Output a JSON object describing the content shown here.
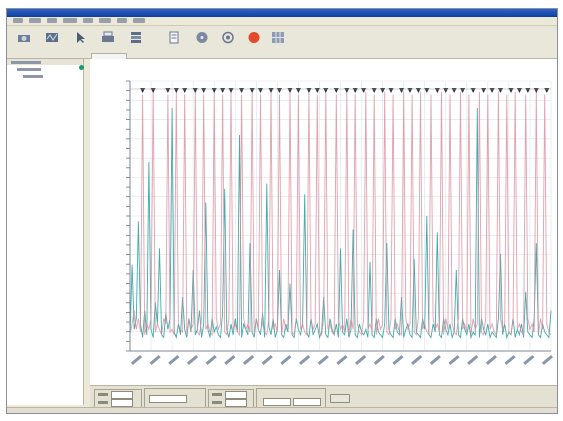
{
  "window": {
    "title": ""
  },
  "menu": {
    "items": [
      "",
      "",
      "",
      "",
      "",
      "",
      "",
      ""
    ]
  },
  "toolbar": {
    "buttons": [
      {
        "name": "",
        "icon": "acquire-icon"
      },
      {
        "name": "",
        "icon": "scope-icon"
      },
      {
        "name": "",
        "icon": "cursor-icon"
      },
      {
        "name": "",
        "icon": "print-icon"
      },
      {
        "name": "",
        "icon": "stack-icon"
      },
      {
        "name": "",
        "icon": "document-icon"
      },
      {
        "name": "",
        "icon": "disk-icon"
      },
      {
        "name": "",
        "icon": "record-icon"
      },
      {
        "name": "",
        "icon": "stop-icon"
      },
      {
        "name": "",
        "icon": "grid-icon"
      }
    ]
  },
  "colors": {
    "primary_trace": "#3aa6a6",
    "secondary_trace": "#d98a9a",
    "marker": "#333333",
    "grid": "#dde3ea",
    "accent": "#e24a2a"
  },
  "chart_data": {
    "type": "line",
    "title": "",
    "xlabel": "",
    "ylabel": "",
    "ylim": [
      0,
      1
    ],
    "grid": true,
    "x": [
      0,
      1,
      2,
      3,
      4,
      5,
      6,
      7,
      8,
      9,
      10,
      11,
      12,
      13,
      14,
      15,
      16,
      17,
      18,
      19,
      20,
      21,
      22,
      23,
      24,
      25,
      26,
      27,
      28,
      29,
      30,
      31,
      32,
      33,
      34,
      35,
      36,
      37,
      38,
      39,
      40,
      41,
      42,
      43,
      44,
      45,
      46,
      47,
      48,
      49,
      50,
      51,
      52,
      53,
      54,
      55,
      56,
      57,
      58,
      59,
      60,
      61,
      62,
      63,
      64,
      65,
      66,
      67,
      68,
      69,
      70,
      71,
      72,
      73,
      74,
      75,
      76,
      77,
      78,
      79,
      80,
      81,
      82,
      83,
      84,
      85,
      86,
      87,
      88,
      89,
      90,
      91,
      92,
      93,
      94,
      95,
      96,
      97,
      98,
      99,
      100,
      101,
      102,
      103,
      104,
      105,
      106,
      107,
      108,
      109,
      110,
      111,
      112,
      113,
      114,
      115,
      116,
      117,
      118,
      119,
      120,
      121,
      122,
      123,
      124,
      125,
      126,
      127,
      128,
      129,
      130,
      131,
      132,
      133,
      134,
      135,
      136,
      137,
      138,
      139,
      140,
      141,
      142,
      143,
      144,
      145,
      146,
      147,
      148,
      149,
      150,
      151,
      152,
      153,
      154,
      155,
      156,
      157,
      158,
      159,
      160,
      161,
      162,
      163,
      164,
      165,
      166,
      167,
      168,
      169,
      170,
      171,
      172,
      173,
      174,
      175,
      176,
      177,
      178,
      179,
      180,
      181,
      182,
      183,
      184,
      185,
      186,
      187,
      188,
      189,
      190,
      191,
      192,
      193,
      194,
      195,
      196,
      197,
      198,
      199,
      200
    ],
    "series": [
      {
        "name": "",
        "color": "#3aa6a6",
        "values": [
          0.05,
          0.32,
          0.08,
          0.12,
          0.48,
          0.1,
          0.05,
          0.15,
          0.06,
          0.7,
          0.08,
          0.05,
          0.18,
          0.1,
          0.38,
          0.06,
          0.05,
          0.14,
          0.08,
          0.12,
          0.9,
          0.07,
          0.05,
          0.1,
          0.06,
          0.2,
          0.08,
          0.05,
          0.12,
          0.07,
          0.3,
          0.06,
          0.08,
          0.15,
          0.05,
          0.1,
          0.55,
          0.08,
          0.05,
          0.12,
          0.07,
          0.09,
          0.06,
          0.05,
          0.14,
          0.6,
          0.08,
          0.05,
          0.1,
          0.06,
          0.12,
          0.07,
          0.8,
          0.05,
          0.1,
          0.08,
          0.06,
          0.4,
          0.07,
          0.05,
          0.12,
          0.08,
          0.06,
          0.14,
          0.05,
          0.62,
          0.09,
          0.06,
          0.12,
          0.05,
          0.08,
          0.3,
          0.06,
          0.05,
          0.1,
          0.07,
          0.25,
          0.06,
          0.05,
          0.12,
          0.08,
          0.06,
          0.1,
          0.58,
          0.07,
          0.05,
          0.12,
          0.06,
          0.08,
          0.1,
          0.05,
          0.07,
          0.2,
          0.06,
          0.05,
          0.12,
          0.08,
          0.06,
          0.1,
          0.05,
          0.38,
          0.07,
          0.06,
          0.12,
          0.05,
          0.08,
          0.45,
          0.06,
          0.05,
          0.1,
          0.07,
          0.06,
          0.08,
          0.05,
          0.33,
          0.06,
          0.05,
          0.12,
          0.07,
          0.06,
          0.05,
          0.1,
          0.4,
          0.08,
          0.06,
          0.05,
          0.12,
          0.07,
          0.06,
          0.2,
          0.05,
          0.08,
          0.1,
          0.06,
          0.05,
          0.34,
          0.07,
          0.06,
          0.05,
          0.12,
          0.08,
          0.5,
          0.06,
          0.05,
          0.1,
          0.07,
          0.44,
          0.06,
          0.05,
          0.12,
          0.08,
          0.06,
          0.1,
          0.05,
          0.07,
          0.3,
          0.06,
          0.05,
          0.12,
          0.08,
          0.06,
          0.1,
          0.05,
          0.07,
          0.06,
          0.9,
          0.05,
          0.12,
          0.08,
          0.06,
          0.1,
          0.05,
          0.07,
          0.06,
          0.05,
          0.12,
          0.36,
          0.06,
          0.1,
          0.05,
          0.07,
          0.06,
          0.12,
          0.05,
          0.08,
          0.06,
          0.1,
          0.05,
          0.22,
          0.07,
          0.06,
          0.05,
          0.12,
          0.4,
          0.06,
          0.05,
          0.1,
          0.07,
          0.06,
          0.05,
          0.15,
          0.28,
          0.06,
          0.05
        ]
      },
      {
        "name": "",
        "color": "#d98a9a",
        "values": [
          0.06,
          0.1,
          0.15,
          0.08,
          0.12,
          0.07,
          0.95,
          0.06,
          0.1,
          0.08,
          0.12,
          0.96,
          0.07,
          0.1,
          0.08,
          0.06,
          0.12,
          0.1,
          0.95,
          0.07,
          0.08,
          0.06,
          0.96,
          0.1,
          0.08,
          0.07,
          0.95,
          0.06,
          0.12,
          0.08,
          0.1,
          0.96,
          0.07,
          0.06,
          0.12,
          0.95,
          0.08,
          0.1,
          0.07,
          0.06,
          0.96,
          0.12,
          0.08,
          0.1,
          0.95,
          0.07,
          0.06,
          0.12,
          0.96,
          0.08,
          0.1,
          0.07,
          0.06,
          0.95,
          0.12,
          0.08,
          0.1,
          0.07,
          0.96,
          0.06,
          0.12,
          0.08,
          0.95,
          0.1,
          0.07,
          0.06,
          0.12,
          0.96,
          0.08,
          0.1,
          0.07,
          0.95,
          0.06,
          0.12,
          0.08,
          0.1,
          0.96,
          0.07,
          0.06,
          0.12,
          0.95,
          0.08,
          0.1,
          0.07,
          0.06,
          0.96,
          0.12,
          0.08,
          0.1,
          0.95,
          0.07,
          0.06,
          0.12,
          0.96,
          0.08,
          0.1,
          0.07,
          0.06,
          0.95,
          0.12,
          0.08,
          0.1,
          0.07,
          0.96,
          0.06,
          0.12,
          0.08,
          0.95,
          0.1,
          0.07,
          0.06,
          0.12,
          0.96,
          0.08,
          0.1,
          0.07,
          0.95,
          0.06,
          0.12,
          0.08,
          0.1,
          0.96,
          0.07,
          0.06,
          0.12,
          0.95,
          0.08,
          0.1,
          0.07,
          0.06,
          0.96,
          0.12,
          0.08,
          0.1,
          0.95,
          0.07,
          0.06,
          0.12,
          0.96,
          0.08,
          0.1,
          0.07,
          0.06,
          0.95,
          0.12,
          0.08,
          0.1,
          0.07,
          0.96,
          0.06,
          0.12,
          0.08,
          0.95,
          0.1,
          0.07,
          0.06,
          0.12,
          0.96,
          0.08,
          0.1,
          0.07,
          0.95,
          0.06,
          0.12,
          0.08,
          0.1,
          0.96,
          0.07,
          0.06,
          0.12,
          0.95,
          0.08,
          0.1,
          0.07,
          0.06,
          0.96,
          0.12,
          0.08,
          0.1,
          0.95,
          0.07,
          0.06,
          0.12,
          0.96,
          0.08,
          0.1,
          0.07,
          0.06,
          0.95,
          0.12,
          0.08,
          0.1,
          0.07,
          0.96,
          0.06,
          0.12,
          0.08,
          0.95,
          0.1,
          0.07,
          0.06,
          0.12,
          0.96,
          0.08,
          0.1
        ]
      }
    ],
    "markers": [
      6,
      11,
      18,
      22,
      26,
      31,
      35,
      40,
      44,
      48,
      53,
      58,
      62,
      67,
      71,
      76,
      80,
      85,
      89,
      93,
      98,
      103,
      107,
      111,
      116,
      120,
      124,
      129,
      133,
      137,
      141,
      146,
      150,
      154,
      158,
      163,
      168,
      172,
      176,
      181,
      185,
      189,
      193,
      198
    ]
  }
}
